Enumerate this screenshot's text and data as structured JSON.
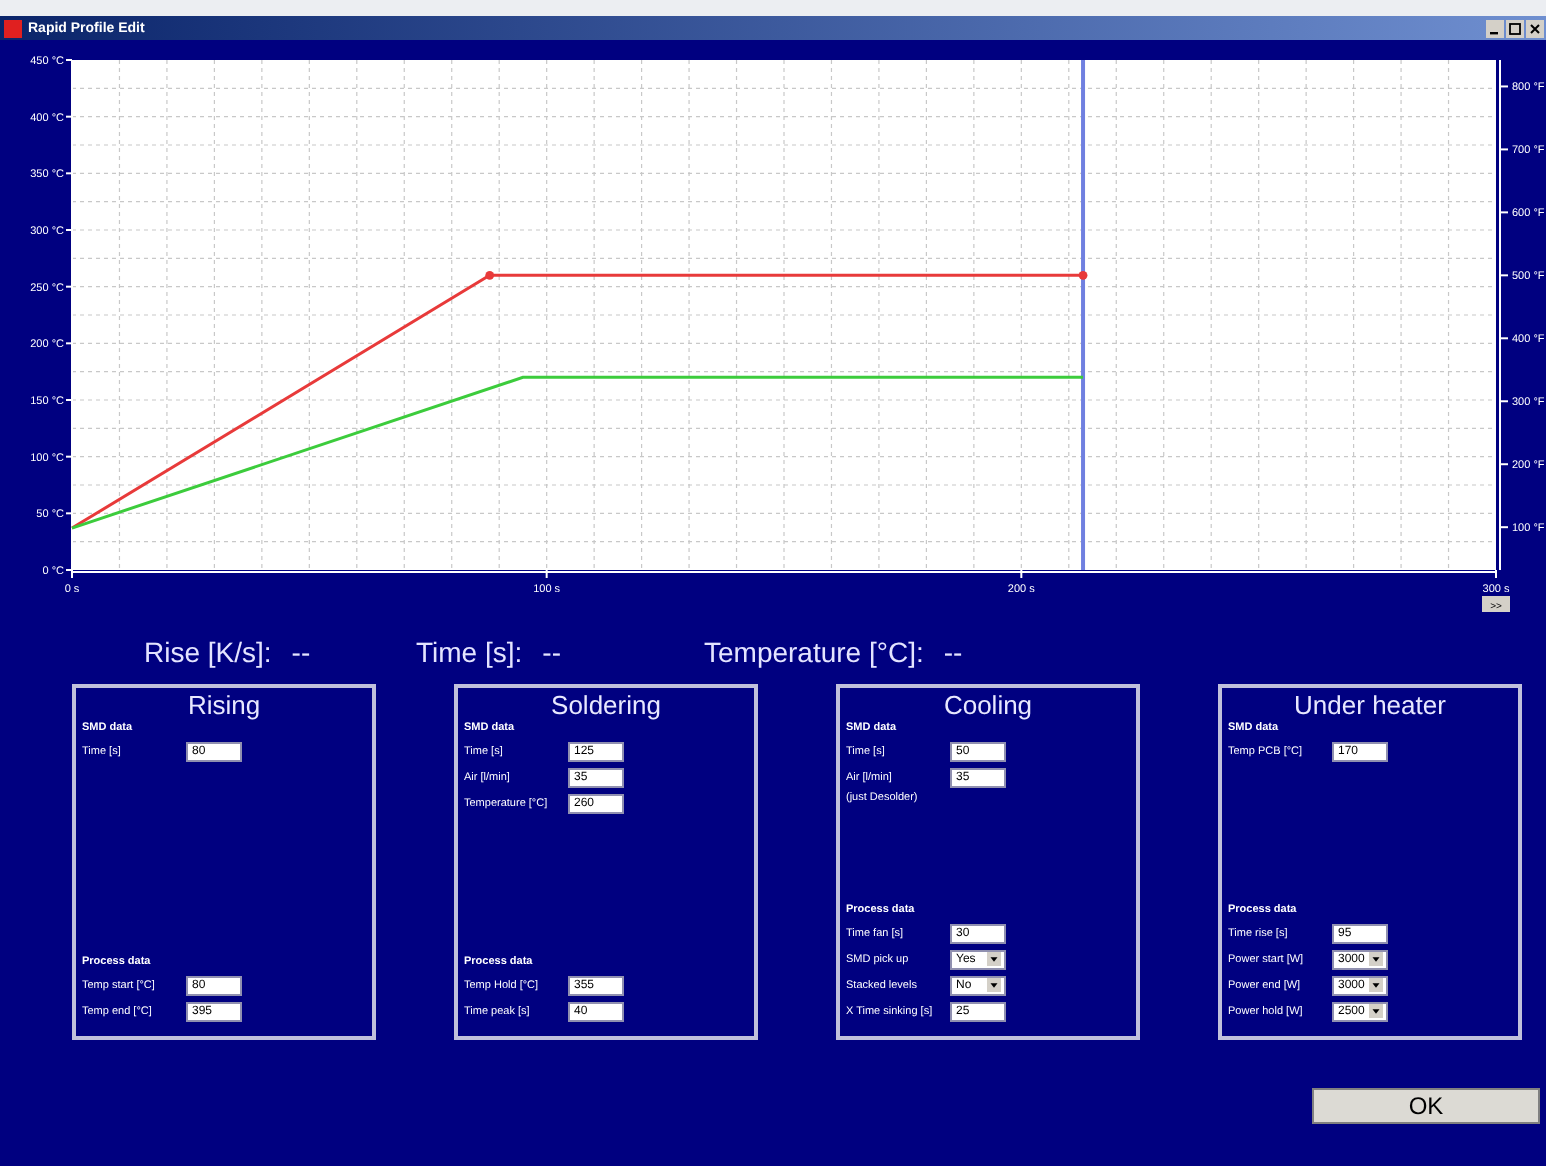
{
  "window": {
    "title": "Rapid Profile Edit"
  },
  "chart": {
    "chart_data": {
      "type": "line",
      "xlim": [
        0,
        300
      ],
      "ylim": [
        0,
        450
      ],
      "xticks": [
        {
          "value": 0,
          "label": "0 s"
        },
        {
          "value": 100,
          "label": "100 s"
        },
        {
          "value": 200,
          "label": "200 s"
        },
        {
          "value": 300,
          "label": "300 s"
        }
      ],
      "yticks": [
        {
          "value": 0,
          "label": "0 °C"
        },
        {
          "value": 50,
          "label": "50 °C"
        },
        {
          "value": 100,
          "label": "100 °C"
        },
        {
          "value": 150,
          "label": "150 °C"
        },
        {
          "value": 200,
          "label": "200 °C"
        },
        {
          "value": 250,
          "label": "250 °C"
        },
        {
          "value": 300,
          "label": "300 °C"
        },
        {
          "value": 350,
          "label": "350 °C"
        },
        {
          "value": 400,
          "label": "400 °C"
        },
        {
          "value": 450,
          "label": "450 °C"
        }
      ],
      "y2ticks": [
        {
          "value": 100,
          "label": "100 °F"
        },
        {
          "value": 200,
          "label": "200 °F"
        },
        {
          "value": 300,
          "label": "300 °F"
        },
        {
          "value": 400,
          "label": "400 °F"
        },
        {
          "value": 500,
          "label": "500 °F"
        },
        {
          "value": 600,
          "label": "600 °F"
        },
        {
          "value": 700,
          "label": "700 °F"
        },
        {
          "value": 800,
          "label": "800 °F"
        }
      ],
      "y2lim": [
        32,
        842
      ],
      "grid": true,
      "series": [
        {
          "color": "#e83a3a",
          "x": [
            0,
            88,
            213
          ],
          "values": [
            37,
            260,
            260
          ]
        },
        {
          "color": "#3ccc3c",
          "x": [
            0,
            95,
            213
          ],
          "values": [
            37,
            170,
            170
          ]
        }
      ],
      "ref_lines": [
        {
          "axis": "x",
          "value": 213
        }
      ]
    },
    "scroll_button": ">>"
  },
  "readings": [
    {
      "label": "Rise [K/s]:",
      "value": "--"
    },
    {
      "label": "Time [s]:",
      "value": "--"
    },
    {
      "label": "Temperature [°C]:",
      "value": "--"
    }
  ],
  "panels": [
    {
      "title": "Rising",
      "smd": {
        "heading": "SMD data",
        "fields": [
          {
            "label": "Time [s]",
            "value": "80",
            "kind": "input"
          }
        ]
      },
      "process": {
        "heading": "Process data",
        "fields": [
          {
            "label": "Temp start [°C]",
            "value": "80",
            "kind": "input"
          },
          {
            "label": "Temp end [°C]",
            "value": "395",
            "kind": "input"
          }
        ]
      }
    },
    {
      "title": "Soldering",
      "smd": {
        "heading": "SMD data",
        "fields": [
          {
            "label": "Time [s]",
            "value": "125",
            "kind": "input"
          },
          {
            "label": "Air [l/min]",
            "value": "35",
            "kind": "input"
          },
          {
            "label": "Temperature [°C]",
            "value": "260",
            "kind": "input"
          }
        ]
      },
      "process": {
        "heading": "Process data",
        "fields": [
          {
            "label": "Temp Hold [°C]",
            "value": "355",
            "kind": "input"
          },
          {
            "label": "Time peak [s]",
            "value": "40",
            "kind": "input"
          }
        ]
      }
    },
    {
      "title": "Cooling",
      "smd": {
        "heading": "SMD data",
        "fields": [
          {
            "label": "Time [s]",
            "value": "50",
            "kind": "input"
          },
          {
            "label": "Air [l/min]",
            "value": "35",
            "kind": "input"
          }
        ],
        "note": "(just Desolder)"
      },
      "process": {
        "heading": "Process data",
        "fields": [
          {
            "label": "Time fan [s]",
            "value": "30",
            "kind": "input"
          },
          {
            "label": "SMD pick up",
            "value": "Yes",
            "kind": "select"
          },
          {
            "label": "Stacked levels",
            "value": "No",
            "kind": "select"
          },
          {
            "label": "X Time sinking [s]",
            "value": "25",
            "kind": "input"
          }
        ]
      }
    },
    {
      "title": "Under heater",
      "smd": {
        "heading": "SMD data",
        "fields": [
          {
            "label": "Temp PCB [°C]",
            "value": "170",
            "kind": "input"
          }
        ]
      },
      "process": {
        "heading": "Process data",
        "fields": [
          {
            "label": "Time rise [s]",
            "value": "95",
            "kind": "input"
          },
          {
            "label": "Power start [W]",
            "value": "3000",
            "kind": "select"
          },
          {
            "label": "Power end [W]",
            "value": "3000",
            "kind": "select"
          },
          {
            "label": "Power hold [W]",
            "value": "2500",
            "kind": "select"
          }
        ]
      }
    }
  ],
  "ok_button": "OK"
}
